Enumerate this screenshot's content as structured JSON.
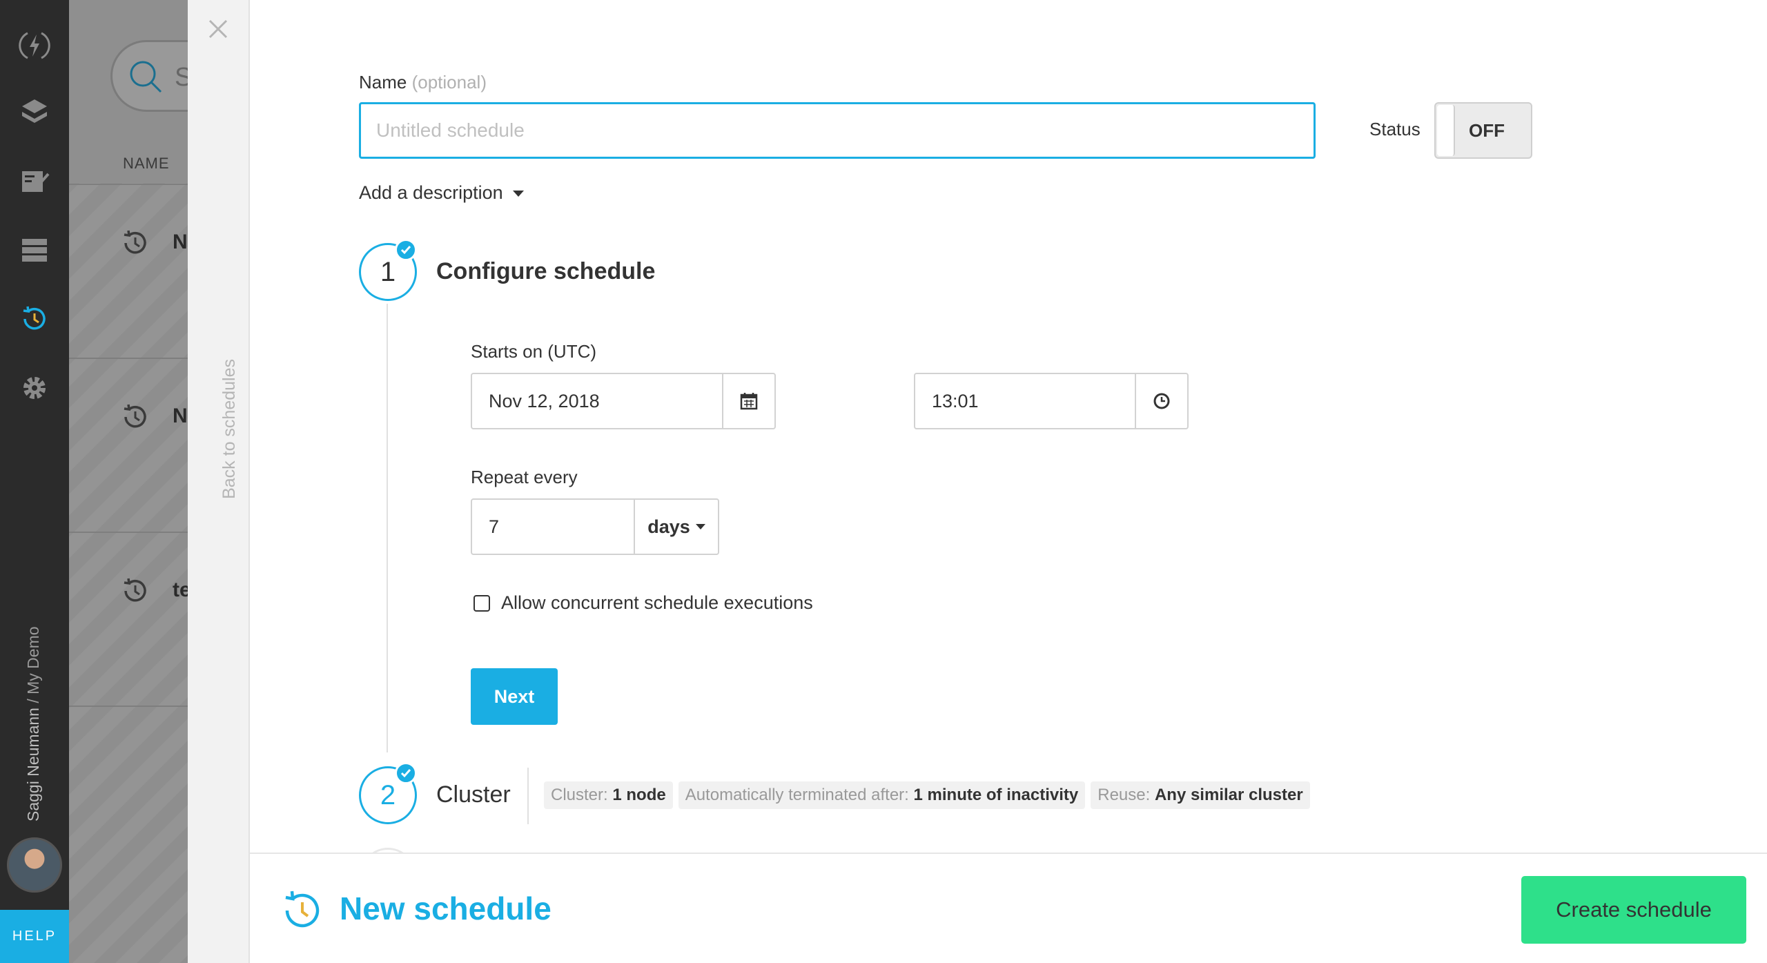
{
  "rail": {
    "icons": [
      "lightning-logo-icon",
      "layers-icon",
      "notebook-check-icon",
      "server-stack-icon",
      "schedule-clock-icon",
      "gear-icon"
    ],
    "active_icon": "schedule-clock-icon",
    "user_name": "Saggi Neumann",
    "user_separator": " / ",
    "workspace": "My Demo",
    "help_label": "HELP"
  },
  "background_list": {
    "search_partial": "S",
    "column_header": "NAME",
    "rows": [
      "N",
      "N",
      "te"
    ]
  },
  "back_strip": {
    "back_label": "Back to schedules"
  },
  "form": {
    "name_label": "Name",
    "name_optional": "(optional)",
    "name_placeholder": "Untitled schedule",
    "name_value": "",
    "status_label": "Status",
    "status_toggle": "OFF",
    "add_description": "Add a description"
  },
  "step1": {
    "number": "1",
    "title": "Configure schedule",
    "starts_on_label": "Starts on (UTC)",
    "date_value": "Nov 12, 2018",
    "time_value": "13:01",
    "repeat_label": "Repeat every",
    "repeat_value": "7",
    "repeat_unit": "days",
    "concurrent_label": "Allow concurrent schedule executions",
    "concurrent_checked": false,
    "next_label": "Next"
  },
  "step2": {
    "number": "2",
    "title": "Cluster",
    "tags": [
      {
        "key": "Cluster:",
        "value": "1 node"
      },
      {
        "key": "Automatically terminated after:",
        "value": "1 minute of inactivity"
      },
      {
        "key": "Reuse:",
        "value": "Any similar cluster"
      }
    ]
  },
  "footer": {
    "title": "New schedule",
    "create_label": "Create schedule"
  },
  "colors": {
    "accent": "#1aaee3",
    "create_button": "#2ee08a",
    "rail_bg": "#2b2b2b"
  }
}
